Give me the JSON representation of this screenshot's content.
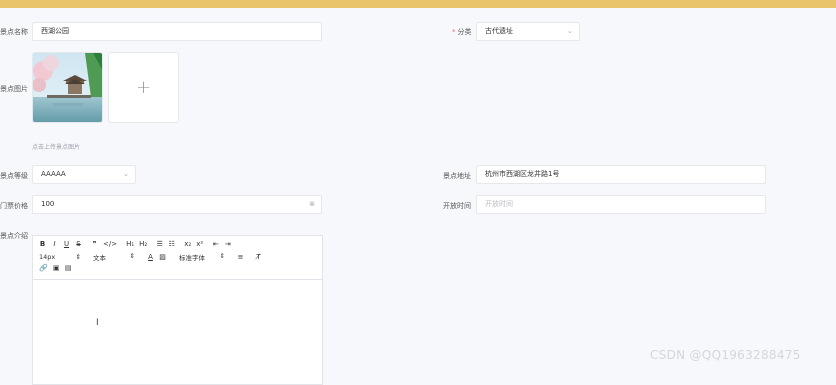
{
  "form": {
    "name": {
      "label": "景点名称",
      "value": "西湖公园"
    },
    "category": {
      "label": "分类",
      "value": "古代遗址"
    },
    "image": {
      "label": "景点图片",
      "add_symbol": "+",
      "hint": "点击上传景点图片"
    },
    "level": {
      "label": "景点等级",
      "value": "AAAAA"
    },
    "address": {
      "label": "景点地址",
      "value": "杭州市西湖区龙井路1号"
    },
    "price": {
      "label": "门票价格",
      "value": "100"
    },
    "open_time": {
      "label": "开放时间",
      "placeholder": "开放时间"
    },
    "intro": {
      "label": "景点介绍"
    }
  },
  "editor": {
    "row1": [
      "B",
      "I",
      "U",
      "S",
      "❞",
      "</>",
      "H₁",
      "H₂",
      "☰",
      "☷",
      "x₂",
      "x²",
      "⇤",
      "⇥"
    ],
    "font_size": "14px",
    "text_type": "文本",
    "font_family": "标准字体",
    "row3": [
      "🔗",
      "▣",
      "▤"
    ]
  },
  "watermark": "CSDN @QQ1963288475",
  "colors": {
    "topbar": "#e9c46a",
    "background": "#f7f8fb"
  }
}
